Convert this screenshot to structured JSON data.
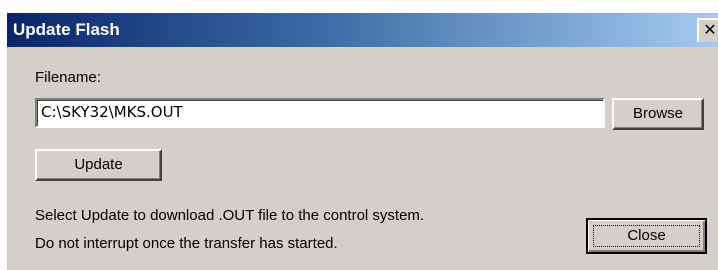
{
  "window": {
    "title": "Update Flash",
    "close_glyph": "✕"
  },
  "form": {
    "filename_label": "Filename:",
    "filename_value": "C:\\SKY32\\MKS.OUT",
    "browse_label": "Browse",
    "update_label": "Update",
    "close_label": "Close"
  },
  "info": {
    "line1": "Select Update to download  .OUT file to the control system.",
    "line2": "Do not interrupt once the transfer has started."
  }
}
